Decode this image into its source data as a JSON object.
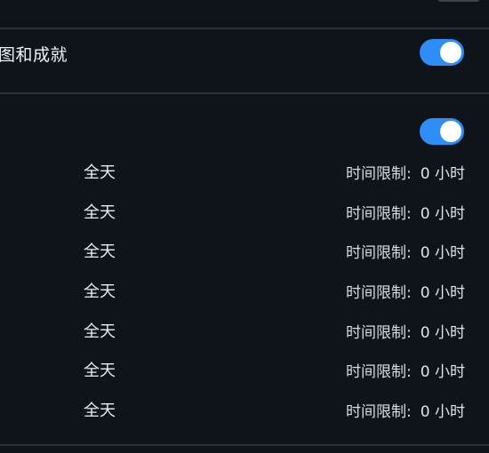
{
  "settings": {
    "achievements_label": "图和成就",
    "achievements_enabled": true,
    "schedule_enabled": true
  },
  "schedule": {
    "rows": [
      {
        "day": "全天",
        "limit_label": "时间限制:",
        "limit_value": "0 小时"
      },
      {
        "day": "全天",
        "limit_label": "时间限制:",
        "limit_value": "0 小时"
      },
      {
        "day": "全天",
        "limit_label": "时间限制:",
        "limit_value": "0 小时"
      },
      {
        "day": "全天",
        "limit_label": "时间限制:",
        "limit_value": "0 小时"
      },
      {
        "day": "全天",
        "limit_label": "时间限制:",
        "limit_value": "0 小时"
      },
      {
        "day": "全天",
        "limit_label": "时间限制:",
        "limit_value": "0 小时"
      },
      {
        "day": "全天",
        "limit_label": "时间限制:",
        "limit_value": "0 小时"
      }
    ]
  },
  "colors": {
    "background": "#0f141b",
    "accent": "#2f8df7",
    "divider": "#2a313a",
    "text": "#e9edf2"
  }
}
